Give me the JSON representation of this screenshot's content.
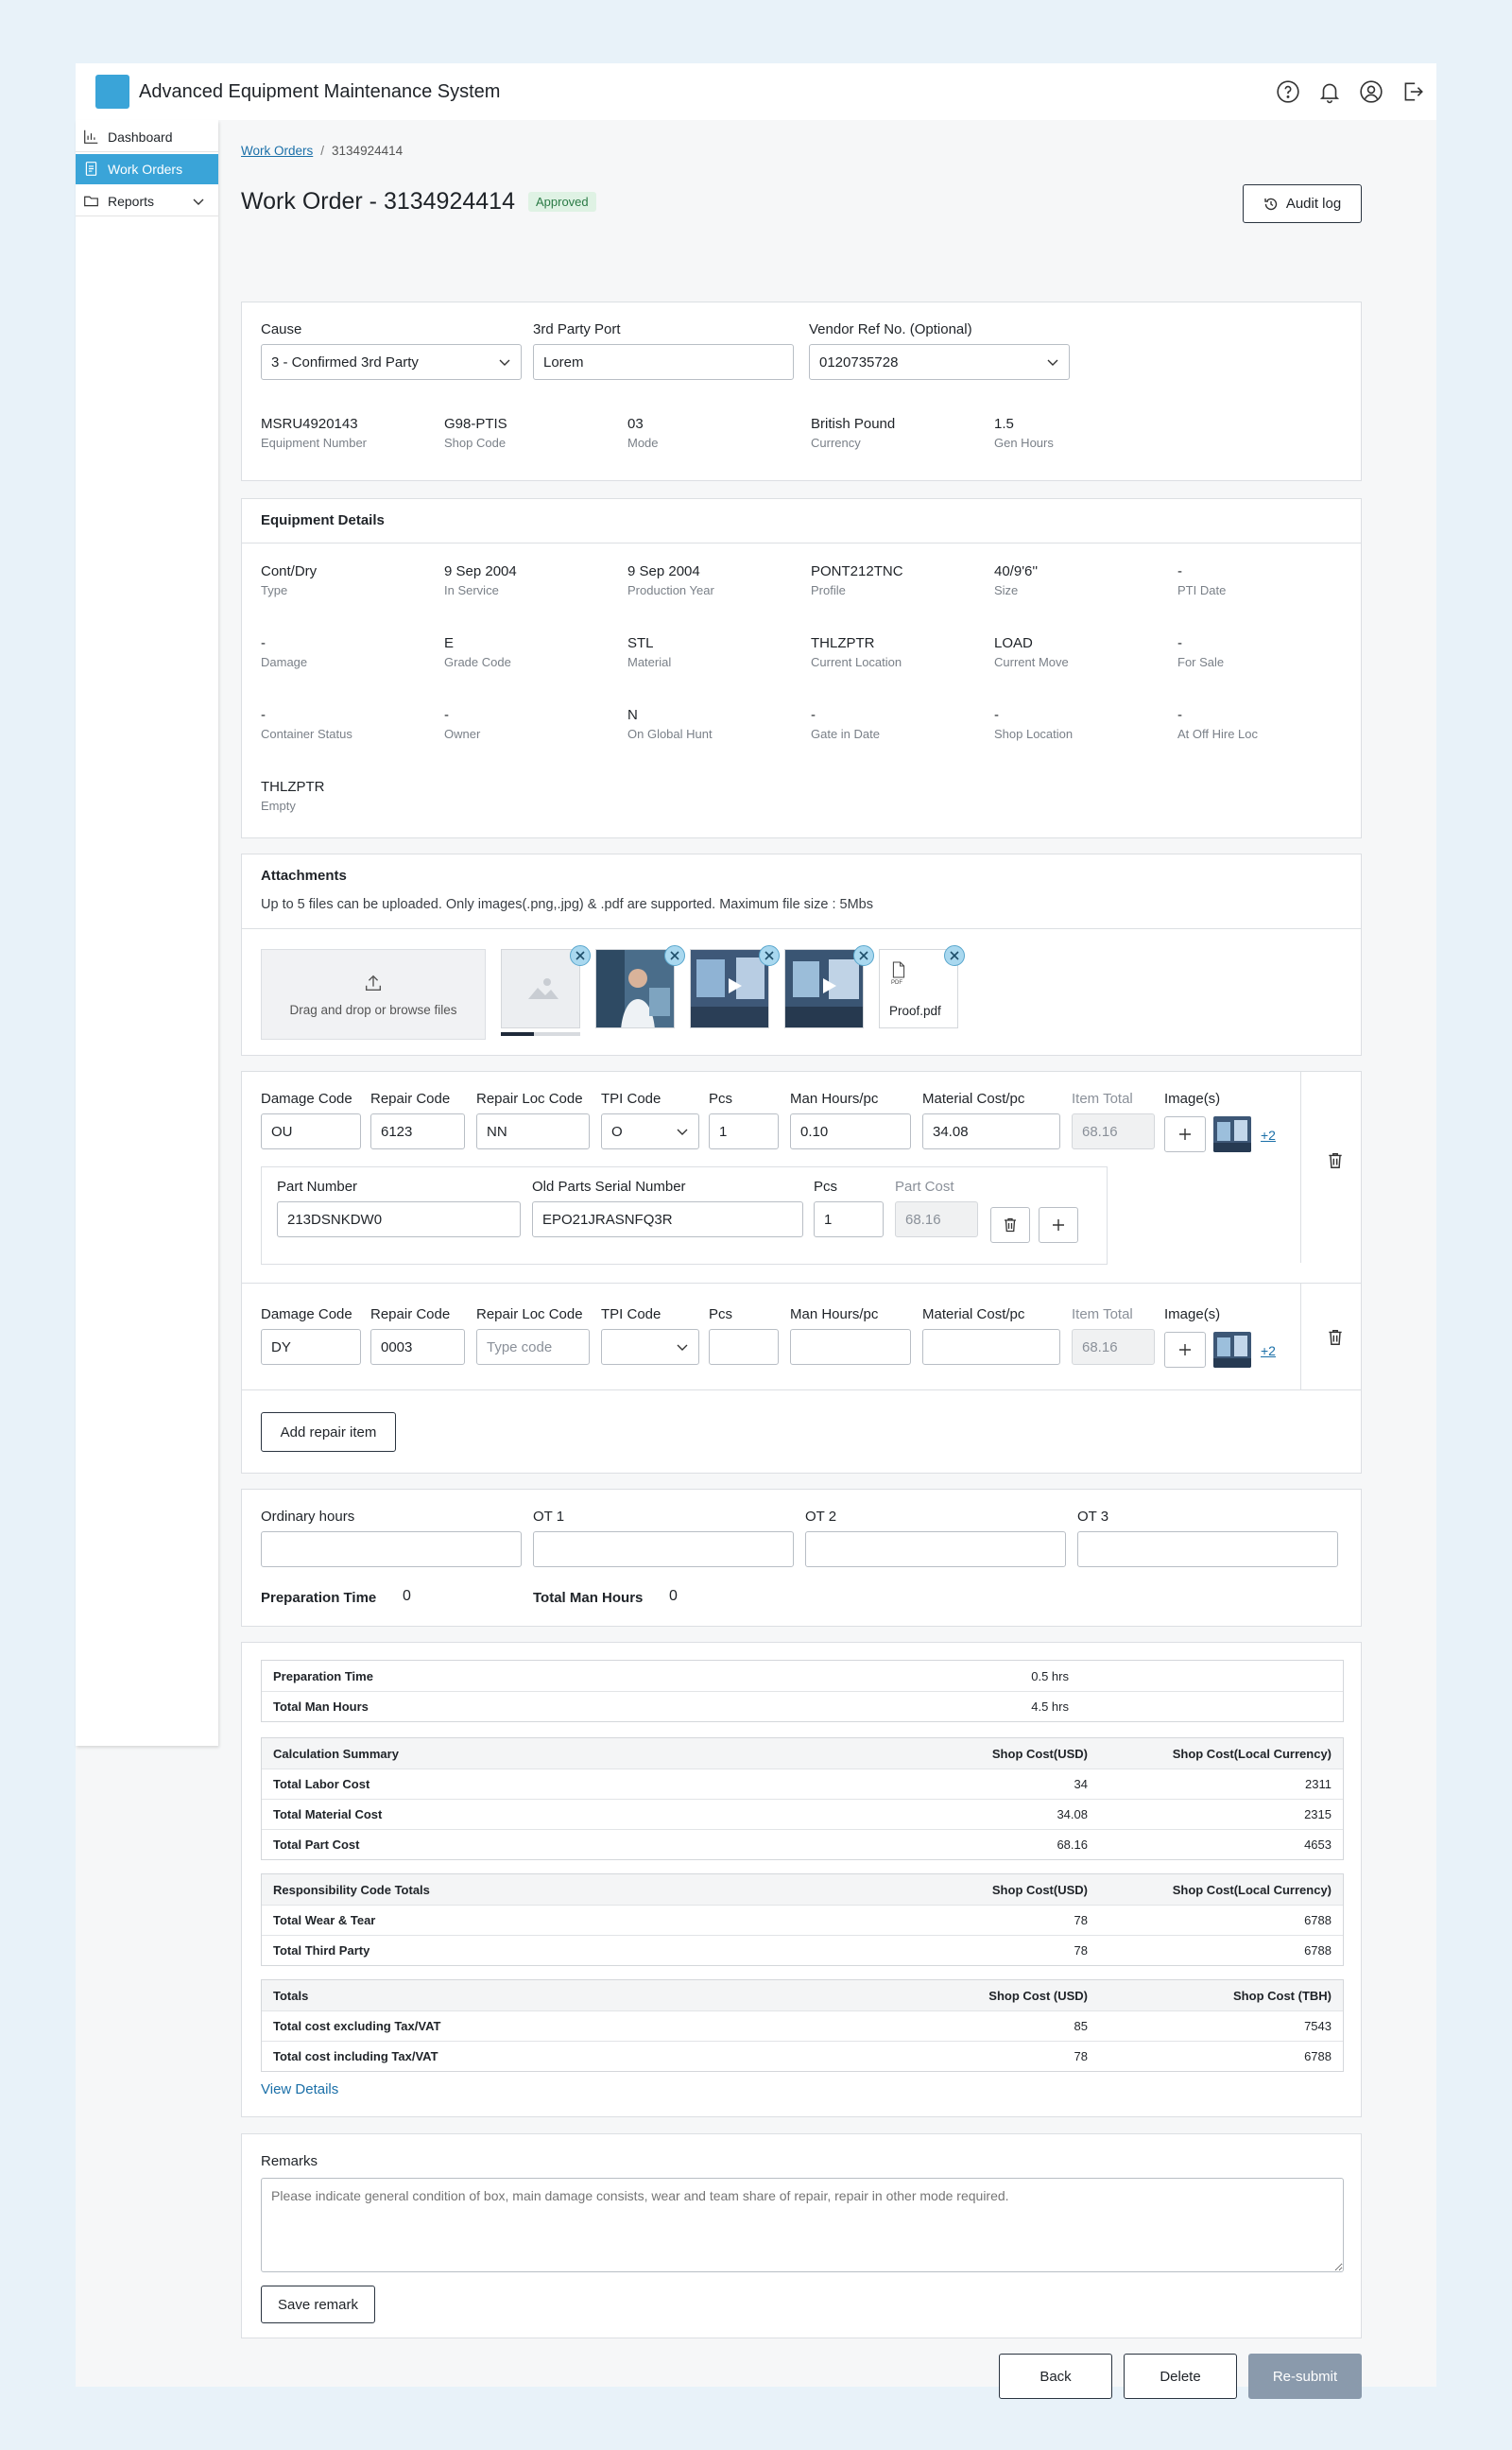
{
  "app": {
    "title": "Advanced Equipment Maintenance System"
  },
  "sidebar": {
    "items": [
      {
        "label": "Dashboard"
      },
      {
        "label": "Work Orders"
      },
      {
        "label": "Reports"
      }
    ]
  },
  "breadcrumb": {
    "parent": "Work Orders",
    "current": "3134924414"
  },
  "header": {
    "title": "Work Order - 3134924414",
    "status": "Approved",
    "audit_label": "Audit log"
  },
  "summary": {
    "cause_label": "Cause",
    "cause_value": "3 - Confirmed 3rd Party",
    "port_label": "3rd Party Port",
    "port_value": "Lorem",
    "vendor_label": "Vendor Ref No. (Optional)",
    "vendor_value": "0120735728",
    "facts": [
      {
        "value": "MSRU4920143",
        "key": "Equipment Number"
      },
      {
        "value": "G98-PTIS",
        "key": "Shop Code"
      },
      {
        "value": "03",
        "key": "Mode"
      },
      {
        "value": "British Pound",
        "key": "Currency"
      },
      {
        "value": "1.5",
        "key": "Gen Hours"
      }
    ]
  },
  "equipment": {
    "title": "Equipment Details",
    "rows": [
      [
        {
          "value": "Cont/Dry",
          "key": "Type"
        },
        {
          "value": "9 Sep 2004",
          "key": "In Service"
        },
        {
          "value": "9 Sep 2004",
          "key": "Production Year"
        },
        {
          "value": "PONT212TNC",
          "key": "Profile"
        },
        {
          "value": "40/9'6''",
          "key": "Size"
        },
        {
          "value": "-",
          "key": "PTI Date"
        }
      ],
      [
        {
          "value": "-",
          "key": "Damage"
        },
        {
          "value": "E",
          "key": "Grade Code"
        },
        {
          "value": "STL",
          "key": "Material"
        },
        {
          "value": "THLZPTR",
          "key": "Current Location"
        },
        {
          "value": "LOAD",
          "key": "Current Move"
        },
        {
          "value": "-",
          "key": "For Sale"
        }
      ],
      [
        {
          "value": "-",
          "key": "Container Status"
        },
        {
          "value": "-",
          "key": "Owner"
        },
        {
          "value": "N",
          "key": "On Global Hunt"
        },
        {
          "value": "-",
          "key": "Gate in Date"
        },
        {
          "value": "-",
          "key": "Shop Location"
        },
        {
          "value": "-",
          "key": "At Off Hire Loc"
        }
      ],
      [
        {
          "value": "THLZPTR",
          "key": "Empty"
        }
      ]
    ]
  },
  "attachments": {
    "title": "Attachments",
    "hint": "Up to 5 files can be uploaded. Only images(.png,.jpg) & .pdf are supported. Maximum file size : 5Mbs",
    "dropzone": "Drag and drop or browse files",
    "pdf_name": "Proof.pdf",
    "pdf_tag": "PDF",
    "upload_progress": 0.42
  },
  "repair_items": {
    "labels": {
      "damage": "Damage Code",
      "repair": "Repair Code",
      "loc": "Repair Loc Code",
      "tpi": "TPI Code",
      "pcs": "Pcs",
      "hours": "Man Hours/pc",
      "material": "Material Cost/pc",
      "total": "Item Total",
      "images": "Image(s)"
    },
    "item1": {
      "damage": "OU",
      "repair": "6123",
      "loc": "NN",
      "tpi": "O",
      "pcs": "1",
      "hours": "0.10",
      "material": "34.08",
      "total": "68.16",
      "more": "+2"
    },
    "part": {
      "part_label": "Part Number",
      "part_value": "213DSNKDW0",
      "serial_label": "Old Parts Serial Number",
      "serial_value": "EPO21JRASNFQ3R",
      "pcs_label": "Pcs",
      "pcs_value": "1",
      "cost_label": "Part Cost",
      "cost_value": "68.16"
    },
    "item2": {
      "damage": "DY",
      "repair": "0003",
      "loc_placeholder": "Type code",
      "tpi": "",
      "pcs": "",
      "hours": "",
      "material": "",
      "total": "68.16",
      "more": "+2"
    },
    "add_label": "Add repair item"
  },
  "hours": {
    "ordinary": "Ordinary hours",
    "ot1": "OT 1",
    "ot2": "OT 2",
    "ot3": "OT 3",
    "prep_label": "Preparation Time",
    "prep_value": "0",
    "total_label": "Total Man Hours",
    "total_value": "0"
  },
  "costs": {
    "time": [
      {
        "label": "Preparation Time",
        "value": "0.5 hrs"
      },
      {
        "label": "Total Man Hours",
        "value": "4.5 hrs"
      }
    ],
    "calc": {
      "head": [
        "Calculation Summary",
        "Shop Cost(USD)",
        "Shop Cost(Local Currency)"
      ],
      "rows": [
        [
          "Total Labor Cost",
          "34",
          "2311"
        ],
        [
          "Total Material Cost",
          "34.08",
          "2315"
        ],
        [
          "Total Part Cost",
          "68.16",
          "4653"
        ]
      ]
    },
    "resp": {
      "head": [
        "Responsibility Code Totals",
        "Shop Cost(USD)",
        "Shop Cost(Local Currency)"
      ],
      "rows": [
        [
          "Total Wear & Tear",
          "78",
          "6788"
        ],
        [
          "Total Third Party",
          "78",
          "6788"
        ]
      ]
    },
    "totals": {
      "head": [
        "Totals",
        "Shop Cost (USD)",
        "Shop Cost (TBH)"
      ],
      "rows": [
        [
          "Total cost excluding Tax/VAT",
          "85",
          "7543"
        ],
        [
          "Total cost including Tax/VAT",
          "78",
          "6788"
        ]
      ]
    },
    "view_details": "View Details"
  },
  "remarks": {
    "label": "Remarks",
    "placeholder": "Please indicate general condition of box, main damage consists, wear and team share of repair, repair in other mode required.",
    "save_label": "Save remark"
  },
  "actions": {
    "back": "Back",
    "delete": "Delete",
    "resubmit": "Re-submit"
  }
}
